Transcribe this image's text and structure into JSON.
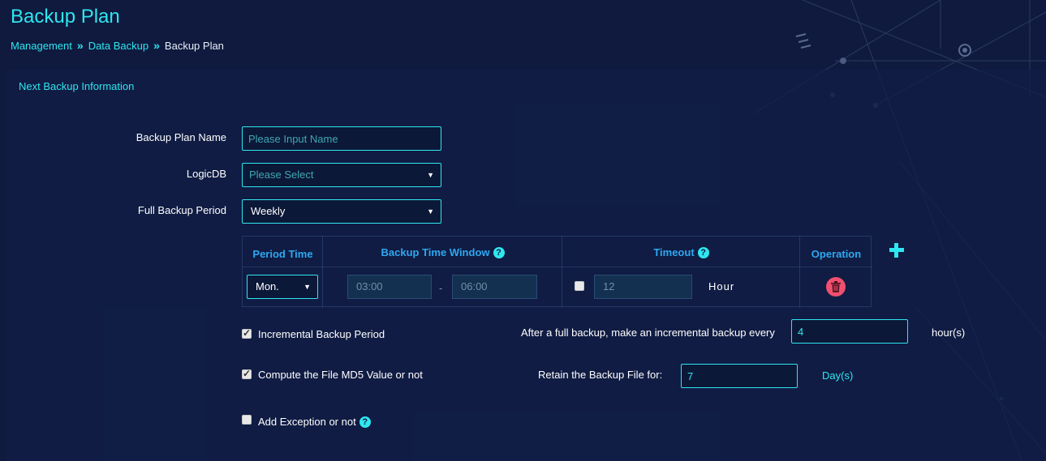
{
  "page": {
    "title": "Backup Plan"
  },
  "breadcrumb": {
    "items": [
      "Management",
      "Data Backup"
    ],
    "current": "Backup Plan"
  },
  "section": {
    "title": "Next Backup Information"
  },
  "form": {
    "plan_name_label": "Backup Plan Name",
    "plan_name_placeholder": "Please Input Name",
    "plan_name_value": "",
    "logicdb_label": "LogicDB",
    "logicdb_placeholder": "Please Select",
    "full_period_label": "Full Backup Period",
    "full_period_value": "Weekly"
  },
  "period_table": {
    "headers": {
      "period_time": "Period Time",
      "backup_window": "Backup Time Window",
      "timeout": "Timeout",
      "operation": "Operation"
    },
    "rows": [
      {
        "period": "Mon.",
        "window_start": "03:00",
        "window_end": "06:00",
        "separator": "-",
        "timeout_checked": false,
        "timeout_value": "12",
        "timeout_unit": "Hour"
      }
    ]
  },
  "options": {
    "incremental": {
      "label": "Incremental Backup Period",
      "checked": true,
      "desc": "After a full backup, make an incremental backup every",
      "value": "4",
      "unit": "hour(s)"
    },
    "md5": {
      "label": "Compute the File MD5 Value or not",
      "checked": true,
      "retain_label": "Retain the Backup File for:",
      "retain_value": "7",
      "retain_unit": "Day(s)"
    },
    "exception": {
      "label": "Add Exception or not",
      "checked": false
    }
  },
  "help_glyph": "?",
  "icons": [
    "help-icon",
    "trash-icon",
    "plus-icon",
    "chevron-down-icon"
  ],
  "colors": {
    "background": "#0f1a3e",
    "accent": "#2ee6f0",
    "header_text": "#2ea8f0",
    "delete": "#f0506e"
  }
}
